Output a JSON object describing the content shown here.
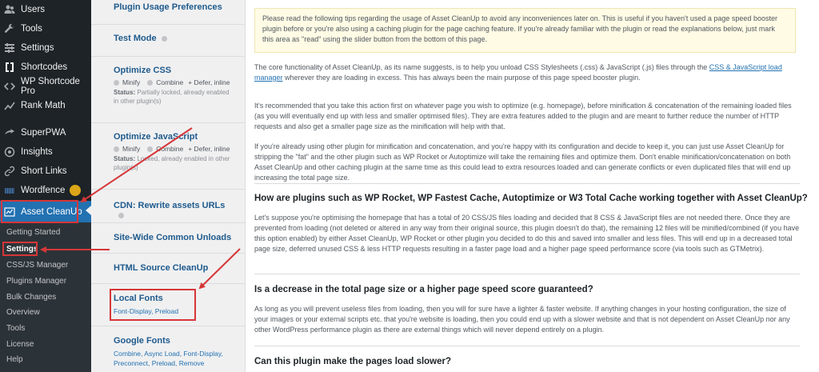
{
  "sidebar": {
    "items": [
      {
        "label": "Users",
        "icon": "users-icon"
      },
      {
        "label": "Tools",
        "icon": "wrench-icon"
      },
      {
        "label": "Settings",
        "icon": "settings-icon"
      },
      {
        "label": "Shortcodes",
        "icon": "brackets-icon"
      },
      {
        "label": "WP Shortcode Pro",
        "icon": "code-icon"
      },
      {
        "label": "Rank Math",
        "icon": "chart-icon"
      },
      {
        "label": "SuperPWA",
        "icon": "pwa-icon"
      },
      {
        "label": "Insights",
        "icon": "insights-icon"
      },
      {
        "label": "Short Links",
        "icon": "link-icon"
      },
      {
        "label": "Wordfence",
        "icon": "wordfence-icon"
      },
      {
        "label": "Asset CleanUp",
        "icon": "asset-cleanup-icon"
      }
    ],
    "submenu": [
      "Getting Started",
      "Settings",
      "CSS/JS Manager",
      "Plugins Manager",
      "Bulk Changes",
      "Overview",
      "Tools",
      "License",
      "Help"
    ],
    "accent": "#2271b1",
    "badge_color": "#dba617"
  },
  "settings_menu": {
    "plugin_usage": "Plugin Usage Preferences",
    "test_mode": "Test Mode",
    "optimize_css": {
      "title": "Optimize CSS",
      "opt1": "Minify",
      "opt2": "Combine",
      "opt3": "+ Defer, inline",
      "status_label": "Status:",
      "status": "Partially locked, already enabled in other plugin(s)"
    },
    "optimize_js": {
      "title": "Optimize JavaScript",
      "opt1": "Minify",
      "opt2": "Combine",
      "opt3": "+ Defer, inline",
      "status_label": "Status:",
      "status": "Locked, already enabled in other plugin(s)"
    },
    "cdn": "CDN: Rewrite assets URLs",
    "site_wide": "Site-Wide Common Unloads",
    "html_source": "HTML Source CleanUp",
    "local_fonts": {
      "title": "Local Fonts",
      "sub": "Font-Display, Preload"
    },
    "google_fonts": {
      "title": "Google Fonts",
      "sub": "Combine, Async Load, Font-Display, Preconnect, Preload, Remove"
    }
  },
  "content": {
    "notice": "Please read the following tips regarding the usage of Asset CleanUp to avoid any inconveniences later on. This is useful if you haven't used a page speed booster plugin before or you're also using a caching plugin for the page caching feature. If you're already familiar with the plugin or read the explanations below, just mark this area as \"read\" using the slider button from the bottom of this page.",
    "p1_a": "The core functionality of Asset CleanUp, as its name suggests, is to help you unload CSS Stylesheets (.css) & JavaScript (.js) files through the ",
    "p1_link": "CSS & JavaScript load manager",
    "p1_b": " wherever they are loading in excess. This has always been the main purpose of this page speed booster plugin.",
    "p2": "It's recommended that you take this action first on whatever page you wish to optimize (e.g. homepage), before minification & concatenation of the remaining loaded files (as you will eventually end up with less and smaller optimised files). They are extra features added to the plugin and are meant to further reduce the number of HTTP requests and also get a smaller page size as the minification will help with that.",
    "p3": "If you're already using other plugin for minification and concatenation, and you're happy with its configuration and decide to keep it, you can just use Asset CleanUp for stripping the \"fat\" and the other plugin such as WP Rocket or Autoptimize will take the remaining files and optimize them. Don't enable minification/concatenation on both Asset CleanUp and other caching plugin at the same time as this could lead to extra resources loaded and can generate conflicts or even duplicated files that will end up increasing the total page size.",
    "h1": "How are plugins such as WP Rocket, WP Fastest Cache, Autoptimize or W3 Total Cache working together with Asset CleanUp?",
    "p4": "Let's suppose you're optimising the homepage that has a total of 20 CSS/JS files loading and decided that 8 CSS & JavaScript files are not needed there. Once they are prevented from loading (not deleted or altered in any way from their original source, this plugin doesn't do that), the remaining 12 files will be minified/combined (if you have this option enabled) by either Asset CleanUp, WP Rocket or other plugin you decided to do this and saved into smaller and less files. This will end up in a decreased total page size, deferred unused CSS & less HTTP requests resulting in a faster page load and a higher page speed performance score (via tools such as GTMetrix).",
    "h2": "Is a decrease in the total page size or a higher page speed score guaranteed?",
    "p5": "As long as you will prevent useless files from loading, then you will for sure have a lighter & faster website. If anything changes in your hosting configuration, the size of your images or your external scripts etc. that you're website is loading, then you could end up with a slower website and that is not dependent on Asset CleanUp nor any other WordPress performance plugin as there are external things which will never depend entirely on a plugin.",
    "h3": "Can this plugin make the pages load slower?"
  },
  "highlight_color": "#d63638"
}
